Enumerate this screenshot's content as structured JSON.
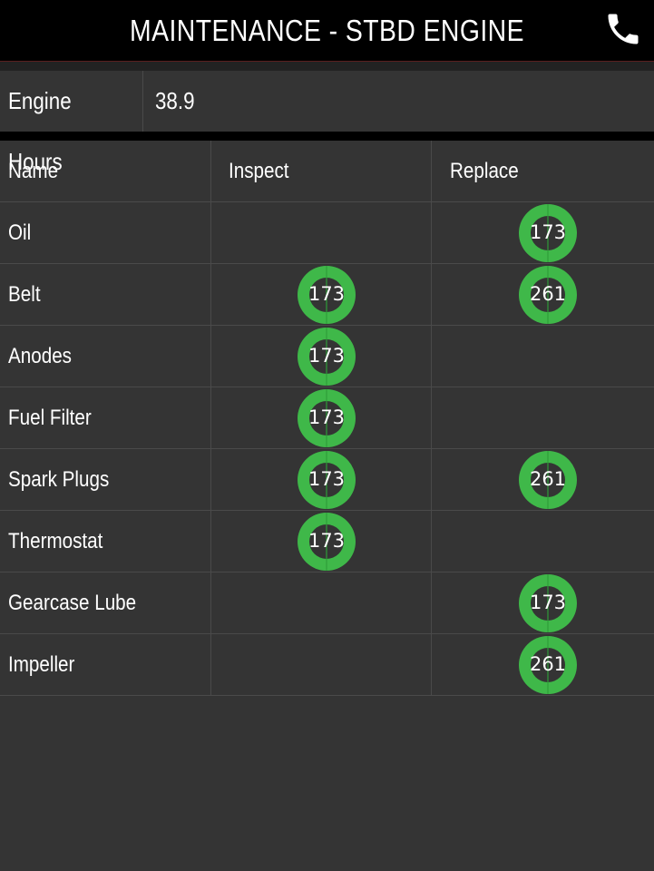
{
  "header": {
    "title": "MAINTENANCE - STBD ENGINE",
    "phone_icon": "phone-icon"
  },
  "engine_hours": {
    "label": "Engine Hours",
    "value": "38.9"
  },
  "table": {
    "columns": [
      "Name",
      "Inspect",
      "Replace"
    ],
    "rows": [
      {
        "name": "Oil",
        "inspect": null,
        "replace": "173"
      },
      {
        "name": "Belt",
        "inspect": "173",
        "replace": "261"
      },
      {
        "name": "Anodes",
        "inspect": "173",
        "replace": null
      },
      {
        "name": "Fuel Filter",
        "inspect": "173",
        "replace": null
      },
      {
        "name": "Spark Plugs",
        "inspect": "173",
        "replace": "261"
      },
      {
        "name": "Thermostat",
        "inspect": "173",
        "replace": null
      },
      {
        "name": "Gearcase Lube",
        "inspect": null,
        "replace": "173"
      },
      {
        "name": "Impeller",
        "inspect": null,
        "replace": "261"
      }
    ]
  },
  "colors": {
    "background": "#343434",
    "header": "#000000",
    "ring_green": "#3fb849"
  }
}
